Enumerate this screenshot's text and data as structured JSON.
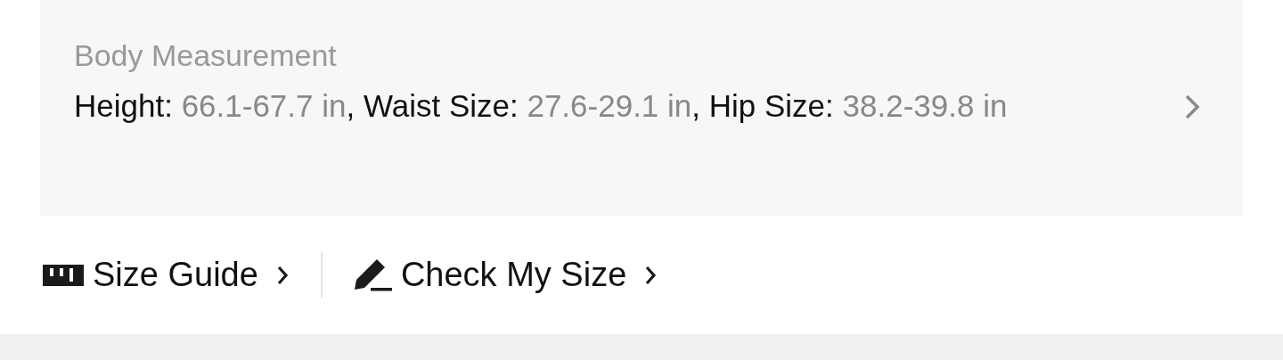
{
  "body_measurement": {
    "title": "Body Measurement",
    "items": [
      {
        "label": "Height:",
        "value": "66.1-67.7 in",
        "separator": ","
      },
      {
        "label": "Waist Size:",
        "value": "27.6-29.1 in",
        "separator": ","
      },
      {
        "label": "Hip Size:",
        "value": "38.2-39.8 in"
      }
    ]
  },
  "links": [
    {
      "kind": "ruler",
      "label": "Size Guide"
    },
    {
      "kind": "pencil",
      "label": "Check My Size"
    }
  ]
}
